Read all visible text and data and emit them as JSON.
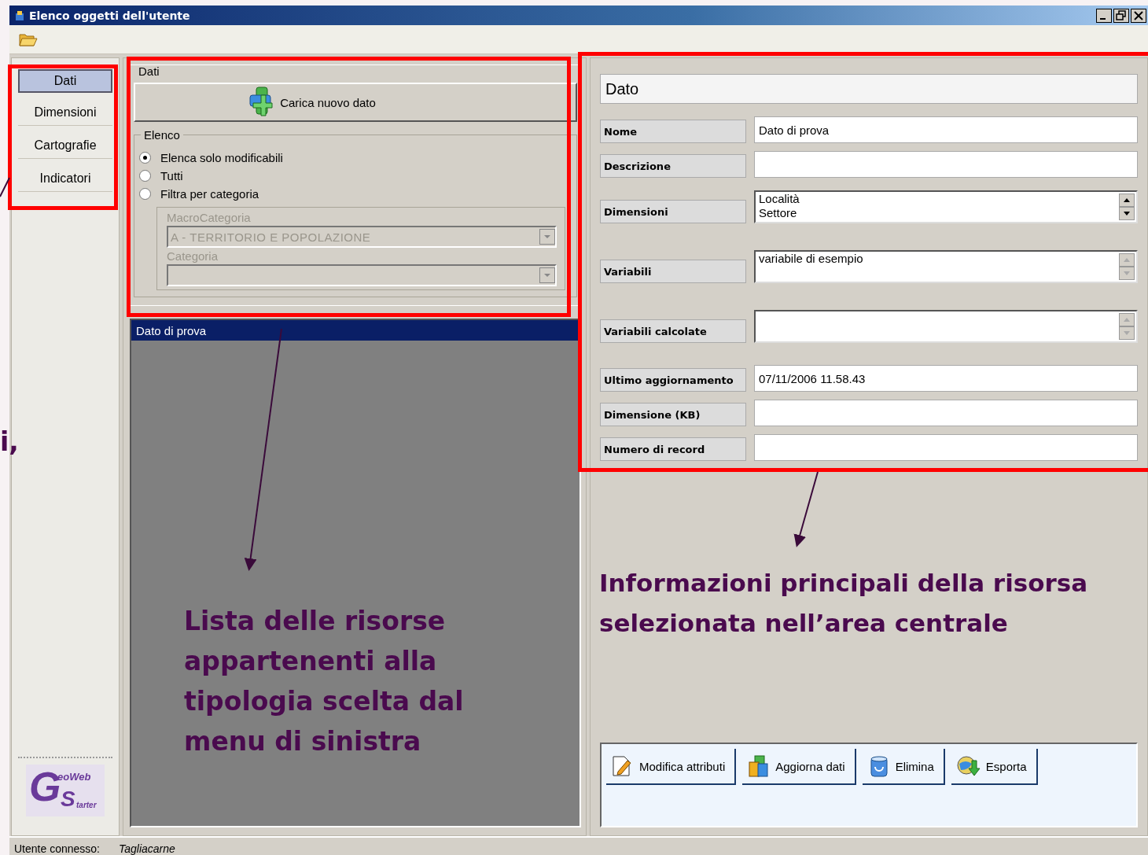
{
  "window": {
    "title": "Elenco oggetti dell'utente"
  },
  "nav": [
    {
      "label": "Dati",
      "selected": true
    },
    {
      "label": "Dimensioni",
      "selected": false
    },
    {
      "label": "Cartografie",
      "selected": false
    },
    {
      "label": "Indicatori",
      "selected": false
    }
  ],
  "logo": {
    "parts": [
      "G",
      "eoWeb",
      "S",
      "tarter"
    ]
  },
  "data_group": {
    "title": "Dati",
    "upload_button": "Carica nuovo dato"
  },
  "elenco": {
    "title": "Elenco",
    "options": [
      {
        "label": "Elenca solo modificabili",
        "selected": true
      },
      {
        "label": "Tutti",
        "selected": false
      },
      {
        "label": "Filtra per categoria",
        "selected": false
      }
    ],
    "filters": [
      {
        "label": "MacroCategoria",
        "value": "A - TERRITORIO E POPOLAZIONE",
        "disabled": true
      },
      {
        "label": "Categoria",
        "disabled": true
      }
    ]
  },
  "list": {
    "items": [
      {
        "label": "Dato di prova",
        "selected": true
      }
    ]
  },
  "detail": {
    "title": "Dato",
    "fields": [
      {
        "label": "Nome",
        "kind": "text",
        "value": "Dato di prova"
      },
      {
        "label": "Descrizione",
        "kind": "text"
      },
      {
        "label": "Dimensioni",
        "kind": "list",
        "lines": [
          "Località",
          "Settore"
        ],
        "scroll_enabled": true
      },
      {
        "label": "Variabili",
        "kind": "list",
        "lines": [
          "variabile di esempio"
        ],
        "scroll_enabled": false
      },
      {
        "label": "Variabili calcolate",
        "kind": "list",
        "scroll_enabled": false
      },
      {
        "label": "Ultimo aggiornamento",
        "kind": "text",
        "value": "07/11/2006 11.58.43"
      },
      {
        "label": "Dimensione (KB)",
        "kind": "text"
      },
      {
        "label": "Numero di record",
        "kind": "text"
      }
    ]
  },
  "actions": [
    {
      "label": "Modifica attributi",
      "kind": "edit"
    },
    {
      "label": "Aggiorna dati",
      "kind": "update"
    },
    {
      "label": "Elimina",
      "kind": "delete"
    },
    {
      "label": "Esporta",
      "kind": "export"
    }
  ],
  "status_bar": {
    "label": "Utente connesso:",
    "user": "Tagliacarne"
  },
  "annotations": [
    {
      "kind": "fragment",
      "lines": [
        "i,"
      ]
    },
    {
      "kind": "list",
      "lines": [
        "Lista delle risorse",
        "appartenenti alla",
        "tipologia scelta dal",
        "menu di sinistra"
      ]
    },
    {
      "kind": "detail",
      "lines": [
        "Informazioni principali della risorsa",
        "selezionata nell’area centrale"
      ]
    }
  ]
}
